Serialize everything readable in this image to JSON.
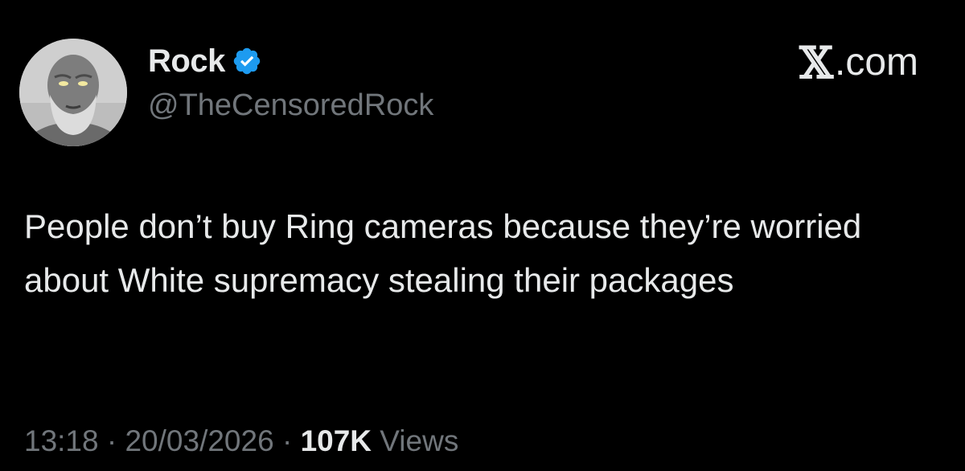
{
  "author": {
    "display_name": "Rock",
    "handle": "@TheCensoredRock",
    "verified": true,
    "verified_color": "#1d9bf0",
    "avatar_icon": "bald-bearded-man-avatar"
  },
  "brand": {
    "logo_icon": "x-logo-icon",
    "logo_glyph": "𝕏",
    "domain": ".com"
  },
  "tweet": {
    "text": "People don’t buy Ring cameras because they’re worried about White supremacy stealing their packages"
  },
  "meta": {
    "time": "13:18",
    "separator": " · ",
    "date": "20/03/2026",
    "views_count": "107K",
    "views_label": " Views"
  },
  "colors": {
    "background": "#000000",
    "primary_text": "#e7e9ea",
    "secondary_text": "#71767b"
  }
}
